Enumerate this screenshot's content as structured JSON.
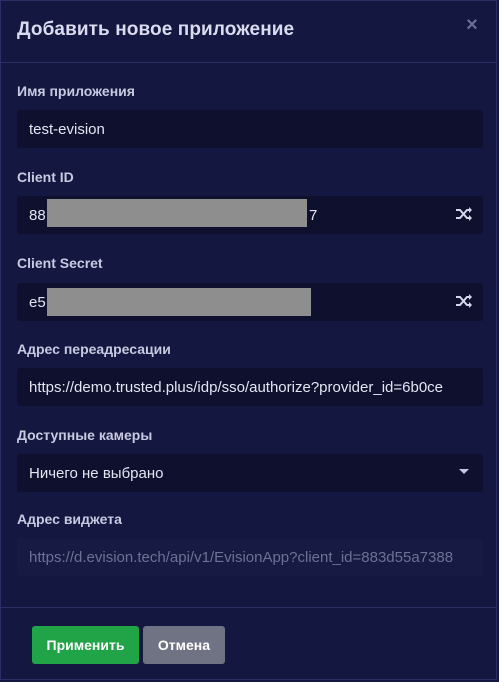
{
  "dialog": {
    "title": "Добавить новое приложение",
    "close_glyph": "×"
  },
  "fields": {
    "app_name": {
      "label": "Имя приложения",
      "value": "test-evision"
    },
    "client_id": {
      "label": "Client ID",
      "value_prefix": "88",
      "value_suffix": "7",
      "action_icon": "shuffle-icon"
    },
    "client_secret": {
      "label": "Client Secret",
      "value_prefix": "e5",
      "action_icon": "shuffle-icon"
    },
    "redirect_url": {
      "label": "Адрес переадресации",
      "value": "https://demo.trusted.plus/idp/sso/authorize?provider_id=6b0ce"
    },
    "cameras": {
      "label": "Доступные камеры",
      "selected": "Ничего не выбрано"
    },
    "widget_url": {
      "label": "Адрес виджета",
      "value": "https://d.evision.tech/api/v1/EvisionApp?client_id=883d55a7388"
    }
  },
  "footer": {
    "apply_label": "Применить",
    "cancel_label": "Отмена"
  },
  "colors": {
    "background": "#14173f",
    "input_background": "#0e102d",
    "apply_button": "#21a447",
    "cancel_button": "#707383",
    "redaction": "#8e8e8e"
  }
}
